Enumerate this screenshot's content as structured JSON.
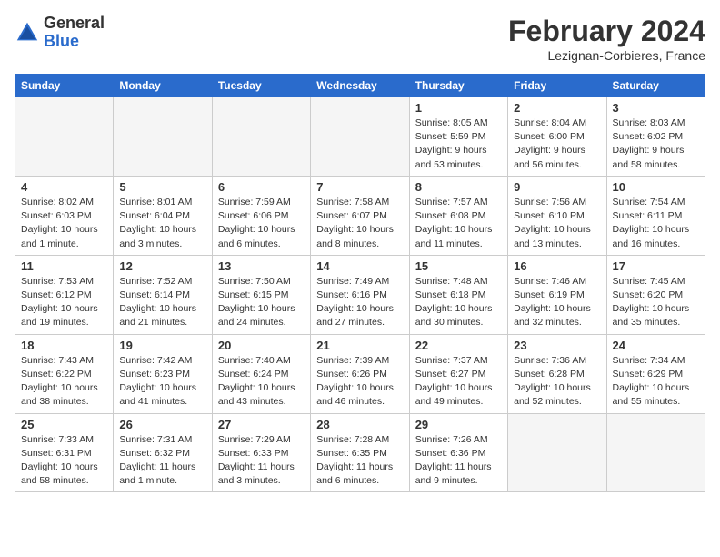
{
  "header": {
    "logo_general": "General",
    "logo_blue": "Blue",
    "month_year": "February 2024",
    "location": "Lezignan-Corbieres, France"
  },
  "weekdays": [
    "Sunday",
    "Monday",
    "Tuesday",
    "Wednesday",
    "Thursday",
    "Friday",
    "Saturday"
  ],
  "weeks": [
    [
      {
        "day": "",
        "sunrise": "",
        "sunset": "",
        "daylight": ""
      },
      {
        "day": "",
        "sunrise": "",
        "sunset": "",
        "daylight": ""
      },
      {
        "day": "",
        "sunrise": "",
        "sunset": "",
        "daylight": ""
      },
      {
        "day": "",
        "sunrise": "",
        "sunset": "",
        "daylight": ""
      },
      {
        "day": "1",
        "sunrise": "Sunrise: 8:05 AM",
        "sunset": "Sunset: 5:59 PM",
        "daylight": "Daylight: 9 hours and 53 minutes."
      },
      {
        "day": "2",
        "sunrise": "Sunrise: 8:04 AM",
        "sunset": "Sunset: 6:00 PM",
        "daylight": "Daylight: 9 hours and 56 minutes."
      },
      {
        "day": "3",
        "sunrise": "Sunrise: 8:03 AM",
        "sunset": "Sunset: 6:02 PM",
        "daylight": "Daylight: 9 hours and 58 minutes."
      }
    ],
    [
      {
        "day": "4",
        "sunrise": "Sunrise: 8:02 AM",
        "sunset": "Sunset: 6:03 PM",
        "daylight": "Daylight: 10 hours and 1 minute."
      },
      {
        "day": "5",
        "sunrise": "Sunrise: 8:01 AM",
        "sunset": "Sunset: 6:04 PM",
        "daylight": "Daylight: 10 hours and 3 minutes."
      },
      {
        "day": "6",
        "sunrise": "Sunrise: 7:59 AM",
        "sunset": "Sunset: 6:06 PM",
        "daylight": "Daylight: 10 hours and 6 minutes."
      },
      {
        "day": "7",
        "sunrise": "Sunrise: 7:58 AM",
        "sunset": "Sunset: 6:07 PM",
        "daylight": "Daylight: 10 hours and 8 minutes."
      },
      {
        "day": "8",
        "sunrise": "Sunrise: 7:57 AM",
        "sunset": "Sunset: 6:08 PM",
        "daylight": "Daylight: 10 hours and 11 minutes."
      },
      {
        "day": "9",
        "sunrise": "Sunrise: 7:56 AM",
        "sunset": "Sunset: 6:10 PM",
        "daylight": "Daylight: 10 hours and 13 minutes."
      },
      {
        "day": "10",
        "sunrise": "Sunrise: 7:54 AM",
        "sunset": "Sunset: 6:11 PM",
        "daylight": "Daylight: 10 hours and 16 minutes."
      }
    ],
    [
      {
        "day": "11",
        "sunrise": "Sunrise: 7:53 AM",
        "sunset": "Sunset: 6:12 PM",
        "daylight": "Daylight: 10 hours and 19 minutes."
      },
      {
        "day": "12",
        "sunrise": "Sunrise: 7:52 AM",
        "sunset": "Sunset: 6:14 PM",
        "daylight": "Daylight: 10 hours and 21 minutes."
      },
      {
        "day": "13",
        "sunrise": "Sunrise: 7:50 AM",
        "sunset": "Sunset: 6:15 PM",
        "daylight": "Daylight: 10 hours and 24 minutes."
      },
      {
        "day": "14",
        "sunrise": "Sunrise: 7:49 AM",
        "sunset": "Sunset: 6:16 PM",
        "daylight": "Daylight: 10 hours and 27 minutes."
      },
      {
        "day": "15",
        "sunrise": "Sunrise: 7:48 AM",
        "sunset": "Sunset: 6:18 PM",
        "daylight": "Daylight: 10 hours and 30 minutes."
      },
      {
        "day": "16",
        "sunrise": "Sunrise: 7:46 AM",
        "sunset": "Sunset: 6:19 PM",
        "daylight": "Daylight: 10 hours and 32 minutes."
      },
      {
        "day": "17",
        "sunrise": "Sunrise: 7:45 AM",
        "sunset": "Sunset: 6:20 PM",
        "daylight": "Daylight: 10 hours and 35 minutes."
      }
    ],
    [
      {
        "day": "18",
        "sunrise": "Sunrise: 7:43 AM",
        "sunset": "Sunset: 6:22 PM",
        "daylight": "Daylight: 10 hours and 38 minutes."
      },
      {
        "day": "19",
        "sunrise": "Sunrise: 7:42 AM",
        "sunset": "Sunset: 6:23 PM",
        "daylight": "Daylight: 10 hours and 41 minutes."
      },
      {
        "day": "20",
        "sunrise": "Sunrise: 7:40 AM",
        "sunset": "Sunset: 6:24 PM",
        "daylight": "Daylight: 10 hours and 43 minutes."
      },
      {
        "day": "21",
        "sunrise": "Sunrise: 7:39 AM",
        "sunset": "Sunset: 6:26 PM",
        "daylight": "Daylight: 10 hours and 46 minutes."
      },
      {
        "day": "22",
        "sunrise": "Sunrise: 7:37 AM",
        "sunset": "Sunset: 6:27 PM",
        "daylight": "Daylight: 10 hours and 49 minutes."
      },
      {
        "day": "23",
        "sunrise": "Sunrise: 7:36 AM",
        "sunset": "Sunset: 6:28 PM",
        "daylight": "Daylight: 10 hours and 52 minutes."
      },
      {
        "day": "24",
        "sunrise": "Sunrise: 7:34 AM",
        "sunset": "Sunset: 6:29 PM",
        "daylight": "Daylight: 10 hours and 55 minutes."
      }
    ],
    [
      {
        "day": "25",
        "sunrise": "Sunrise: 7:33 AM",
        "sunset": "Sunset: 6:31 PM",
        "daylight": "Daylight: 10 hours and 58 minutes."
      },
      {
        "day": "26",
        "sunrise": "Sunrise: 7:31 AM",
        "sunset": "Sunset: 6:32 PM",
        "daylight": "Daylight: 11 hours and 1 minute."
      },
      {
        "day": "27",
        "sunrise": "Sunrise: 7:29 AM",
        "sunset": "Sunset: 6:33 PM",
        "daylight": "Daylight: 11 hours and 3 minutes."
      },
      {
        "day": "28",
        "sunrise": "Sunrise: 7:28 AM",
        "sunset": "Sunset: 6:35 PM",
        "daylight": "Daylight: 11 hours and 6 minutes."
      },
      {
        "day": "29",
        "sunrise": "Sunrise: 7:26 AM",
        "sunset": "Sunset: 6:36 PM",
        "daylight": "Daylight: 11 hours and 9 minutes."
      },
      {
        "day": "",
        "sunrise": "",
        "sunset": "",
        "daylight": ""
      },
      {
        "day": "",
        "sunrise": "",
        "sunset": "",
        "daylight": ""
      }
    ]
  ]
}
